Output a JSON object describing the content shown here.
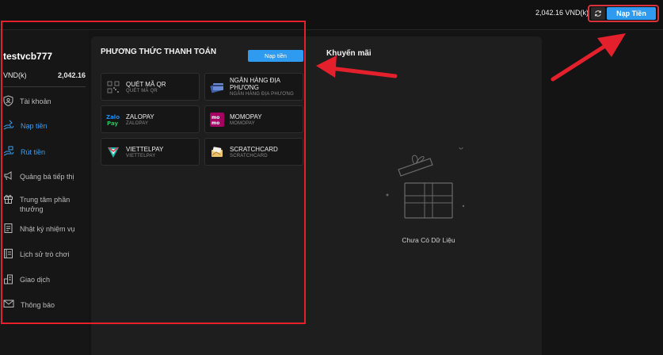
{
  "header": {
    "balance_text": "2,042.16 VND(k)",
    "deposit_label": "Nạp Tiền"
  },
  "sidebar": {
    "username": "testvcb777",
    "currency": "VND(k)",
    "amount": "2,042.16",
    "items": [
      {
        "label": "Tài khoản",
        "icon": "shield-user-icon",
        "active": false
      },
      {
        "label": "Nạp tiền",
        "icon": "deposit-hand-icon",
        "active": true
      },
      {
        "label": "Rút tiền",
        "icon": "withdraw-hand-icon",
        "active": true
      },
      {
        "label": "Quảng bá tiếp thị",
        "icon": "megaphone-icon",
        "active": false
      },
      {
        "label": "Trung tâm phần thưởng",
        "icon": "gift-icon",
        "active": false
      },
      {
        "label": "Nhật ký nhiệm vụ",
        "icon": "task-log-icon",
        "active": false
      },
      {
        "label": "Lịch sử trò chơi",
        "icon": "game-history-icon",
        "active": false
      },
      {
        "label": "Giao dịch",
        "icon": "transactions-icon",
        "active": false
      },
      {
        "label": "Thông báo",
        "icon": "mail-icon",
        "active": false
      }
    ]
  },
  "payment": {
    "title": "PHƯƠNG THỨC THANH TOÁN",
    "deposit_label": "Nạp tiền",
    "methods": [
      {
        "name": "QUÉT MÃ QR",
        "sub": "QUÉT MÃ QR",
        "icon": "qr-icon"
      },
      {
        "name": "NGÂN HÀNG ĐỊA PHƯƠNG",
        "sub": "NGÂN HÀNG ĐỊA PHƯƠNG",
        "icon": "bank-cards-icon"
      },
      {
        "name": "ZALOPAY",
        "sub": "ZALOPAY",
        "icon": "zalopay-logo-icon"
      },
      {
        "name": "MOMOPAY",
        "sub": "MOMOPAY",
        "icon": "momo-logo-icon"
      },
      {
        "name": "VIETTELPAY",
        "sub": "VIETTELPAY",
        "icon": "viettelpay-logo-icon"
      },
      {
        "name": "SCRATCHCARD",
        "sub": "SCRATCHCARD",
        "icon": "scratchcard-icon"
      }
    ]
  },
  "promo": {
    "title": "Khuyến mãi",
    "empty_text": "Chưa Có Dữ Liệu"
  },
  "colors": {
    "accent": "#2e9bf0",
    "highlight_red": "#e3202b"
  }
}
